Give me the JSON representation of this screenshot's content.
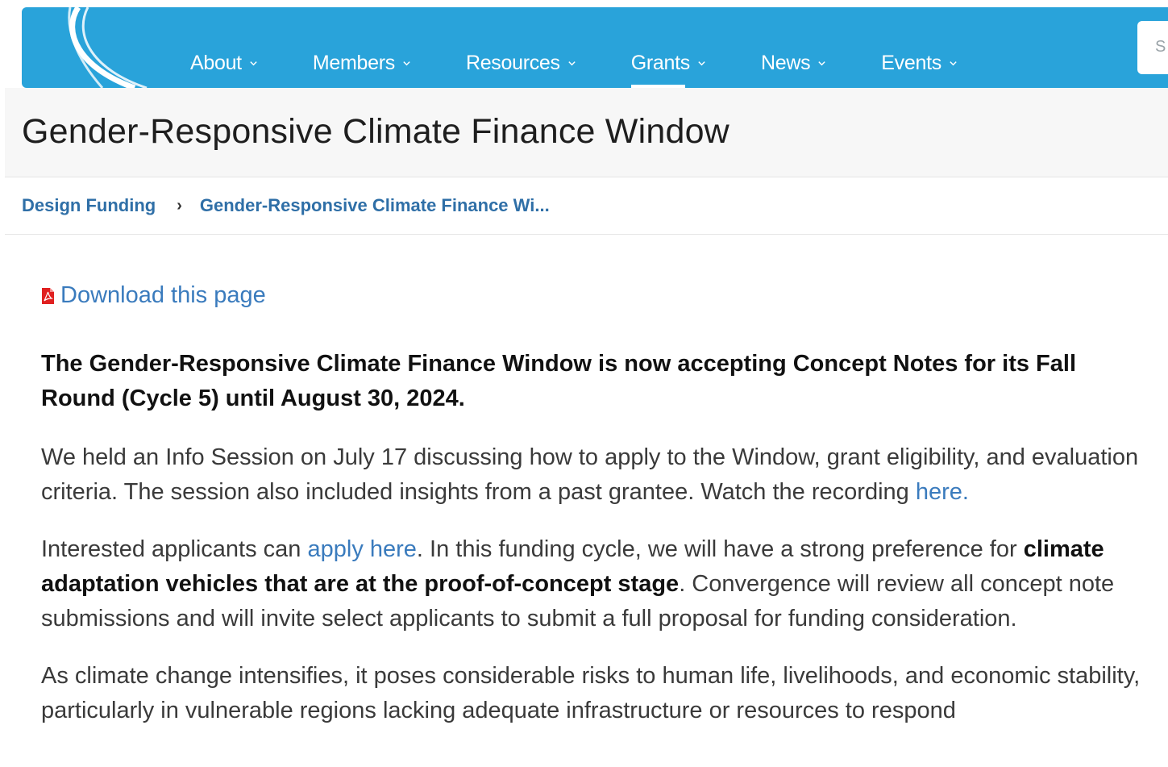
{
  "nav": {
    "items": [
      {
        "label": "About",
        "active": false
      },
      {
        "label": "Members",
        "active": false
      },
      {
        "label": "Resources",
        "active": false
      },
      {
        "label": "Grants",
        "active": true
      },
      {
        "label": "News",
        "active": false
      },
      {
        "label": "Events",
        "active": false
      }
    ],
    "search_placeholder": "S"
  },
  "page_title": "Gender-Responsive Climate Finance Window",
  "breadcrumb": {
    "items": [
      "Design Funding",
      "Gender-Responsive Climate Finance Wi..."
    ],
    "separator": "›"
  },
  "download_label": "Download this page",
  "content": {
    "lead": "The Gender-Responsive Climate Finance Window is now accepting Concept Notes for its Fall Round (Cycle 5) until August 30, 2024.",
    "p1_text": "We held an Info Session on July 17 discussing how to apply to the Window, grant eligibility, and evaluation criteria. The session also included insights from a past grantee. Watch the recording ",
    "p1_link": "here.",
    "p2_text_a": "Interested applicants can ",
    "p2_link": "apply here",
    "p2_text_b": ". In this funding cycle, we will have a strong preference for ",
    "p2_bold": "climate adaptation vehicles that are at the proof-of-concept stage",
    "p2_text_c": ". Convergence will review all concept note submissions and will invite select applicants to submit a full proposal for funding consideration.",
    "p3_text": "As climate change intensifies, it poses considerable risks to human life, livelihoods, and economic stability, particularly in vulnerable regions lacking adequate infrastructure or resources to respond"
  },
  "colors": {
    "nav_bg": "#29a3da",
    "link": "#3a7bbd",
    "breadcrumb_link": "#2f6fa7",
    "pdf_red": "#e02020"
  }
}
